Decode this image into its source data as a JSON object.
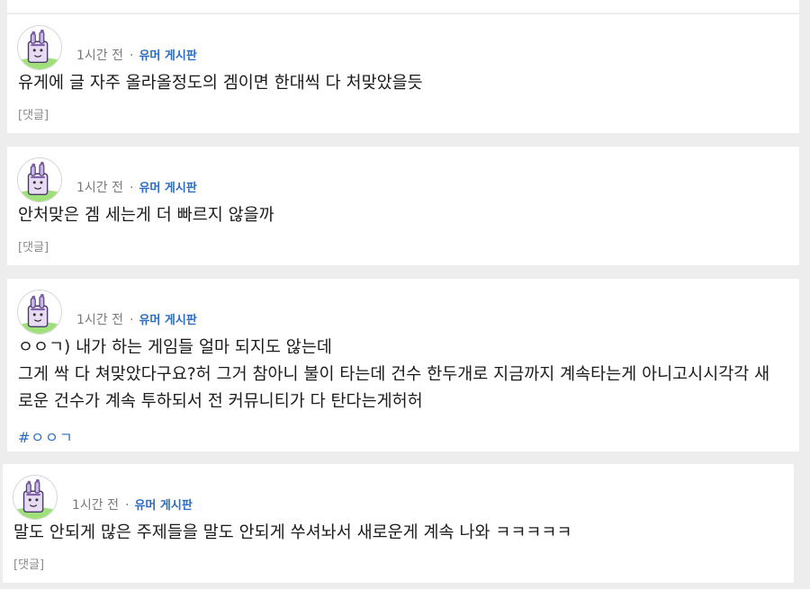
{
  "posts": [
    {
      "time": "1시간 전",
      "separator": "·",
      "board": "유머 게시판",
      "lines": [
        "유게에 글 자주 올라올정도의 겜이면 한대씩 다 처맞았을듯"
      ],
      "comment_label": "[댓글]",
      "tag": ""
    },
    {
      "time": "1시간 전",
      "separator": "·",
      "board": "유머 게시판",
      "lines": [
        "안처맞은 겜 세는게 더 빠르지 않을까"
      ],
      "comment_label": "[댓글]",
      "tag": ""
    },
    {
      "time": "1시간 전",
      "separator": "·",
      "board": "유머 게시판",
      "lines": [
        "ㅇㅇㄱ) 내가 하는 게임들 얼마 되지도 않는데",
        "그게 싹 다 쳐맞았다구요?허 그거 참아니 불이 타는데 건수 한두개로 지금까지 계속타는게 아니고시시각각 새",
        "로운 건수가 계속 투하되서 전 커뮤니티가 다 탄다는게허허"
      ],
      "comment_label": "",
      "tag": "#ㅇㅇㄱ"
    },
    {
      "time": "1시간 전",
      "separator": "·",
      "board": "유머 게시판",
      "lines": [
        "말도 안되게 많은 주제들을 말도 안되게 쑤셔놔서 새로운게 계속 나와 ㅋㅋㅋㅋㅋ"
      ],
      "comment_label": "[댓글]",
      "tag": ""
    }
  ]
}
